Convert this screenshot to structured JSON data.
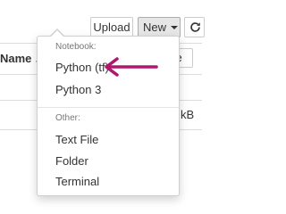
{
  "toolbar": {
    "upload_label": "Upload",
    "new_label": "New",
    "refresh_icon": "refresh-icon"
  },
  "list_header": {
    "name_label": "Name",
    "sort_icon": "arrow-down-icon",
    "size_label_partial": "ze"
  },
  "file_row": {
    "size_partial": "kB"
  },
  "new_menu": {
    "notebook_header": "Notebook:",
    "notebook_items": [
      {
        "label": "Python (tf)"
      },
      {
        "label": "Python 3"
      }
    ],
    "other_header": "Other:",
    "other_items": [
      {
        "label": "Text File"
      },
      {
        "label": "Folder"
      },
      {
        "label": "Terminal"
      }
    ]
  },
  "annotation": {
    "arrow_color": "#b0186d",
    "icon": "pointer-arrow-icon"
  }
}
